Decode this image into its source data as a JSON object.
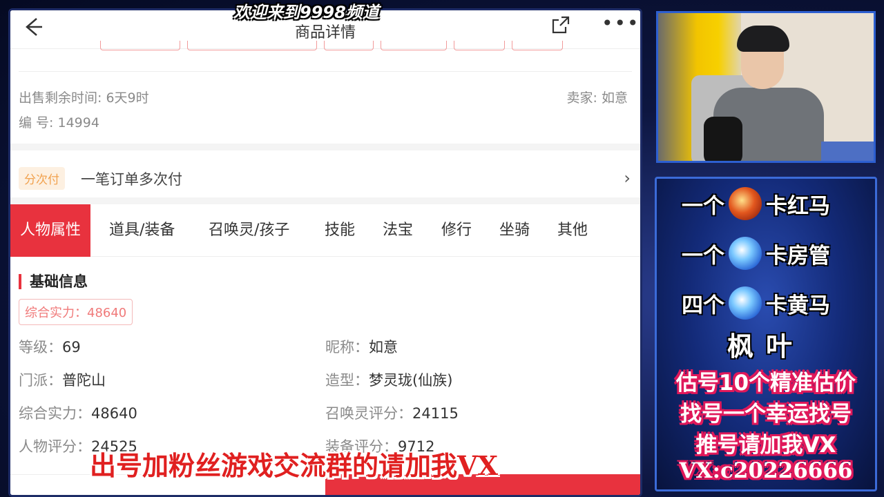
{
  "overlay": {
    "welcome": "欢迎来到9998频道",
    "subtitle": "出号加粉丝游戏交流群的请加我VX"
  },
  "nav": {
    "title": "商品详情",
    "back_icon": "arrow-left-icon",
    "share_icon": "share-icon",
    "more_icon": "more-dots-icon",
    "more_glyph": "•••"
  },
  "sale": {
    "remaining": "出售剩余时间: 6天9时",
    "seller": "卖家: 如意",
    "serial": "编 号: 14994"
  },
  "installment": {
    "badge": "分次付",
    "text": "一笔订单多次付",
    "chevron": "›"
  },
  "tabs": [
    "人物属性",
    "道具/装备",
    "召唤灵/孩子",
    "技能",
    "法宝",
    "修行",
    "坐骑",
    "其他"
  ],
  "basic": {
    "section_title": "基础信息",
    "power_badge": "综合实力：48640",
    "left": [
      {
        "k": "等级：",
        "v": "69"
      },
      {
        "k": "门派：",
        "v": "普陀山"
      },
      {
        "k": "综合实力：",
        "v": "48640"
      },
      {
        "k": "人物评分：",
        "v": "24525"
      }
    ],
    "right": [
      {
        "k": "昵称：",
        "v": "如意"
      },
      {
        "k": "造型：",
        "v": "梦灵珑(仙族)"
      },
      {
        "k": "召唤灵评分：",
        "v": "24115"
      },
      {
        "k": "装备评分：",
        "v": "9712"
      }
    ]
  },
  "side": {
    "rows": [
      {
        "a": "一个",
        "b": "卡红马",
        "orb": "red"
      },
      {
        "a": "一个",
        "b": "卡房管",
        "orb": "blue"
      },
      {
        "a": "四个",
        "b": "卡黄马",
        "orb": "blue"
      }
    ],
    "name": "枫叶",
    "promo": [
      "估号10个精准估价",
      "找号一个幸运找号",
      "推号请加我VX",
      "VX:c20226666"
    ]
  },
  "colors": {
    "accent": "#e8323e",
    "panel_border": "#3b6bd8",
    "promo_stroke": "#e0185a"
  }
}
